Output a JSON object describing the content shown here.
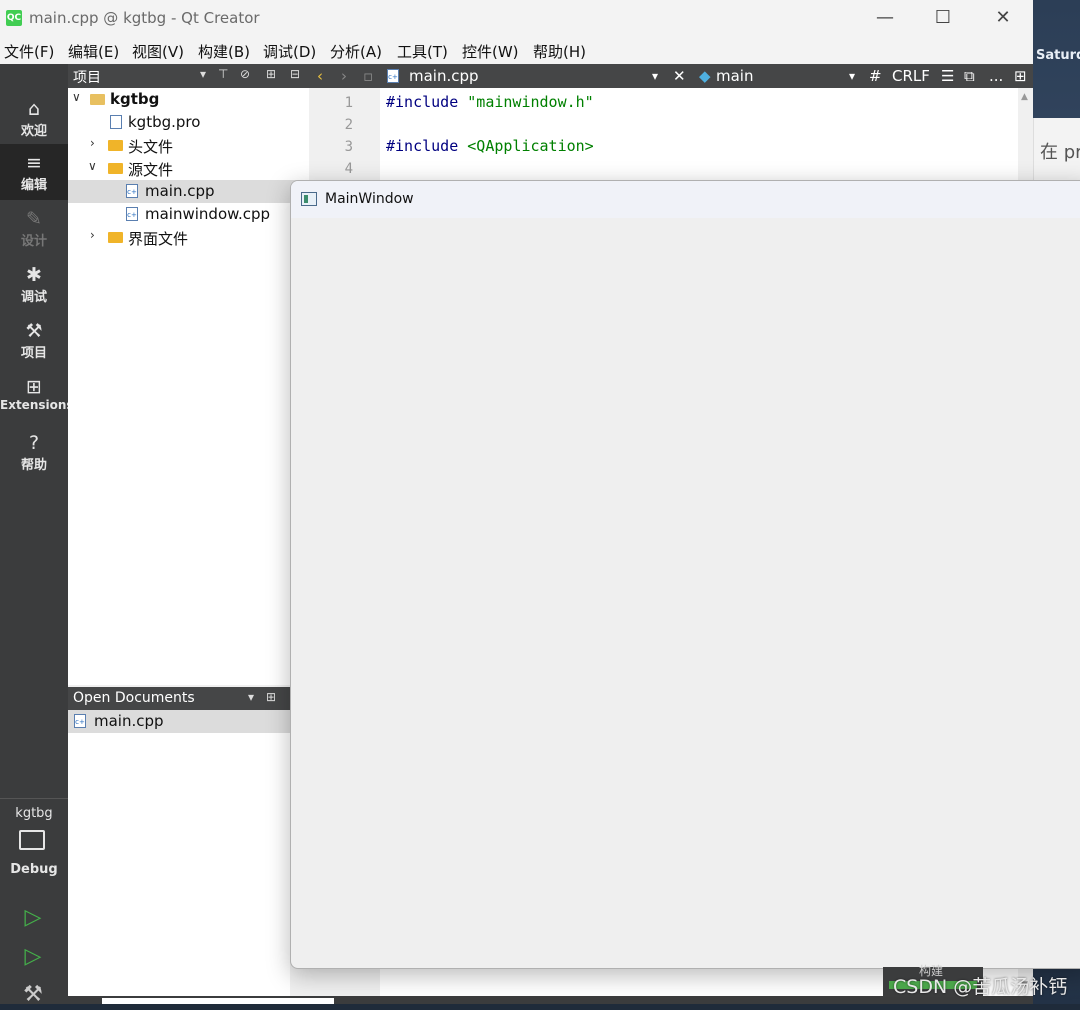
{
  "window": {
    "title": "main.cpp @ kgtbg - Qt Creator",
    "logo_text": "QC",
    "minimize": "—",
    "maximize": "☐",
    "close": "✕"
  },
  "desktop": {
    "label": "Saturda",
    "side_text": "在 pr"
  },
  "menu": [
    "文件(F)",
    "编辑(E)",
    "视图(V)",
    "构建(B)",
    "调试(D)",
    "分析(A)",
    "工具(T)",
    "控件(W)",
    "帮助(H)"
  ],
  "modes": [
    {
      "label": "欢迎",
      "icon": "home-icon"
    },
    {
      "label": "编辑",
      "icon": "edit-icon"
    },
    {
      "label": "设计",
      "icon": "design-icon"
    },
    {
      "label": "调试",
      "icon": "bug-icon"
    },
    {
      "label": "项目",
      "icon": "wrench-icon"
    },
    {
      "label": "Extensions",
      "icon": "extensions-icon"
    },
    {
      "label": "帮助",
      "icon": "help-icon"
    }
  ],
  "kit": {
    "project": "kgtbg",
    "config": "Debug"
  },
  "projects_pane": {
    "title": "项目",
    "tree": [
      {
        "label": "kgtbg",
        "level": 0,
        "expanded": true,
        "kind": "project"
      },
      {
        "label": "kgtbg.pro",
        "level": 1,
        "kind": "pro"
      },
      {
        "label": "头文件",
        "level": 1,
        "expanded": false,
        "kind": "folder"
      },
      {
        "label": "源文件",
        "level": 1,
        "expanded": true,
        "kind": "folder"
      },
      {
        "label": "main.cpp",
        "level": 2,
        "kind": "cpp",
        "selected": true
      },
      {
        "label": "mainwindow.cpp",
        "level": 2,
        "kind": "cpp"
      },
      {
        "label": "界面文件",
        "level": 1,
        "expanded": false,
        "kind": "folder"
      }
    ]
  },
  "open_documents": {
    "title": "Open Documents",
    "items": [
      "main.cpp"
    ]
  },
  "editor": {
    "file": "main.cpp",
    "symbol": "main",
    "hash": "#",
    "line_ending": "CRLF",
    "more": "...",
    "lines": [
      {
        "n": "1",
        "kw": "#include",
        "str": "\"mainwindow.h\""
      },
      {
        "n": "2",
        "kw": "",
        "str": ""
      },
      {
        "n": "3",
        "kw": "#include",
        "str": "<QApplication>"
      },
      {
        "n": "4",
        "kw": "",
        "str": ""
      }
    ]
  },
  "mainwindow": {
    "title": "MainWindow"
  },
  "build": {
    "label": "构建"
  },
  "watermark": "CSDN @苦瓜汤补钙",
  "colors": {
    "modebar": "#3b3c3d",
    "active_mode": "#262626",
    "keyword": "#000080",
    "string": "#008000",
    "run": "#44b04a"
  }
}
